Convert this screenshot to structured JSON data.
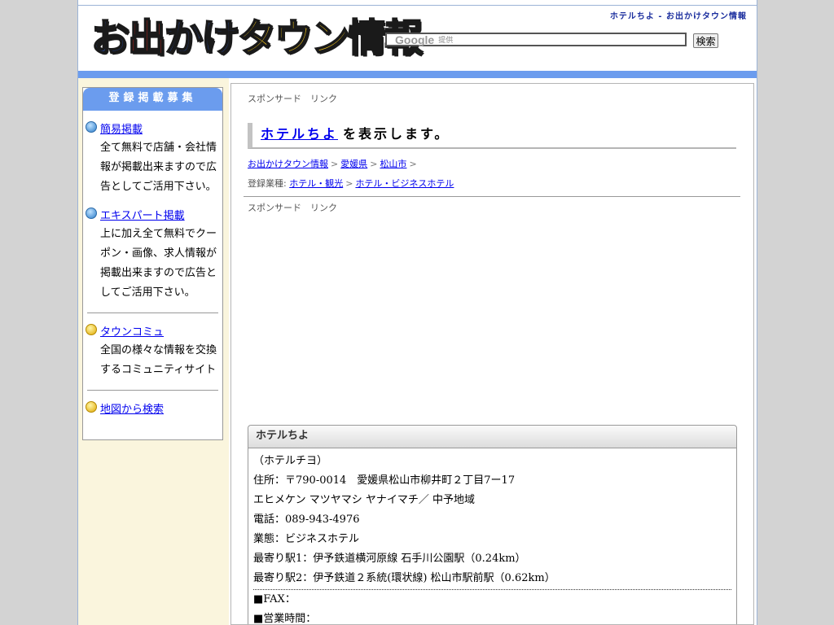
{
  "header": {
    "tagline": "ホテルちよ - お出かけタウン情報",
    "logo_segments": [
      {
        "text": "お",
        "color": "#2a52b8"
      },
      {
        "text": "出",
        "color": "#e0261c"
      },
      {
        "text": "かけ",
        "color": "#2a52b8"
      },
      {
        "text": "タウン",
        "color": "#f0c41a"
      },
      {
        "text": "情報",
        "color": "#31a838"
      }
    ],
    "search": {
      "google_label": "Google",
      "provided_label": "提供",
      "value": ""
    },
    "search_button": "検索"
  },
  "sidebar": {
    "title": "登録掲載募集",
    "items": [
      {
        "icon": "arrow-circle-icon",
        "link": "簡易掲載",
        "desc": "全て無料で店舗・会社情報が掲載出来ますので広告としてご活用下さい。"
      },
      {
        "icon": "arrow-circle-icon",
        "link": "エキスパート掲載",
        "desc": "上に加え全て無料でクーポン・画像、求人情報が掲載出来ますので広告としてご活用下さい。"
      },
      {
        "icon": "yellow-circle-icon",
        "link": "タウンコミュ",
        "desc": "全国の様々な情報を交換するコミュニティサイト"
      },
      {
        "icon": "yellow-circle-icon",
        "link": "地図から検索",
        "desc": ""
      }
    ]
  },
  "main": {
    "sponsor_label": "スポンサード　リンク",
    "title_link": "ホテルちよ",
    "title_suffix": "を表示します。",
    "breadcrumb": [
      "お出かけタウン情報",
      "愛媛県",
      "松山市"
    ],
    "category_label": "登録業種:",
    "categories": [
      "ホテル・観光",
      "ホテル・ビジネスホテル"
    ],
    "sponsor_label_2": "スポンサード　リンク",
    "info": {
      "heading": "ホテルちよ",
      "kana": "（ホテルチヨ）",
      "address": "住所：〒790-0014　愛媛県松山市柳井町２丁目7ー17",
      "address_kana": "エヒメケン マツヤマシ ヤナイマチ／ 中予地域",
      "phone": "電話：089-943-4976",
      "business_type": "業態：ビジネスホテル",
      "station1": "最寄り駅1：伊予鉄道横河原線 石手川公園駅（0.24km）",
      "station2": "最寄り駅2：伊予鉄道２系統(環状線) 松山市駅前駅（0.62km）",
      "fax": "■FAX：",
      "hours": "■営業時間："
    }
  },
  "colors": {
    "accent_blue": "#6b9cee",
    "link": "#0000ee",
    "sidebar_bg": "#faf5dd",
    "page_bg": "#d3d3d3"
  }
}
